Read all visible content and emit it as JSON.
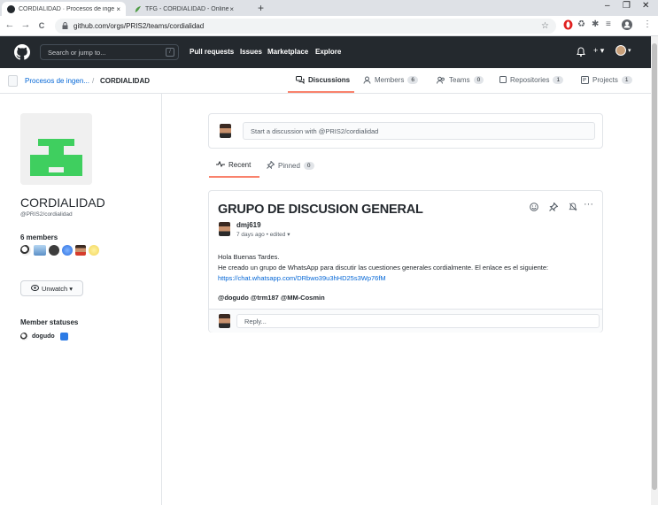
{
  "browser": {
    "tabs": [
      {
        "title": "CORDIALIDAD · Procesos de inge",
        "close": "×"
      },
      {
        "title": "TFG - CORDIALIDAD - Online La",
        "close": "×"
      }
    ],
    "new_tab": "+",
    "url": "github.com/orgs/PRIS2/teams/cordialidad",
    "back": "←",
    "forward": "→",
    "reload": "C",
    "window_controls": [
      "–",
      "❐",
      "✕"
    ]
  },
  "github_header": {
    "search_placeholder": "Search or jump to...",
    "search_key": "/",
    "nav": [
      "Pull requests",
      "Issues",
      "Marketplace",
      "Explore"
    ],
    "plus": "+ ▾",
    "profile_caret": "▾"
  },
  "team_bar": {
    "breadcrumb_org": "Procesos de ingen...",
    "breadcrumb_sep": "/",
    "breadcrumb_team": "CORDIALIDAD",
    "tabs": [
      {
        "label": "Discussions",
        "count": null,
        "selected": true,
        "icon": "comment-discussion-icon"
      },
      {
        "label": "Members",
        "count": "6",
        "icon": "person-icon"
      },
      {
        "label": "Teams",
        "count": "0",
        "icon": "people-icon"
      },
      {
        "label": "Repositories",
        "count": "1",
        "icon": "repo-icon"
      },
      {
        "label": "Projects",
        "count": "1",
        "icon": "project-icon"
      }
    ]
  },
  "sidebar": {
    "team_name": "CORDIALIDAD",
    "team_handle": "@PRIS2/cordialidad",
    "members_label": "6 members",
    "unwatch_label": "Unwatch ▾",
    "statuses_label": "Member statuses",
    "status_user": "dogudo"
  },
  "main": {
    "new_discussion_placeholder": "Start a discussion with @PRIS2/cordialidad",
    "tabs": {
      "recent": "Recent",
      "pinned": "Pinned",
      "pinned_count": "0"
    },
    "post": {
      "title": "GRUPO DE DISCUSION GENERAL",
      "author": "dmj619",
      "meta": "7 days ago • edited ▾",
      "line1": "Hola Buenas Tardes.",
      "line2": "He creado un grupo de WhatsApp para discutir las cuestiones generales cordialmente. El enlace es el siguiente:",
      "link": "https://chat.whatsapp.com/DRbwo39u3hHD25s3Wp76fM",
      "mentions": "@dogudo @trm187 @MM-Cosmin",
      "more": "···",
      "reply_placeholder": "Reply..."
    }
  },
  "colors": {
    "github_header": "#24292e",
    "accent_tab": "#f9826c",
    "link": "#0366d6",
    "team_avatar_green": "#3fcf5f"
  }
}
